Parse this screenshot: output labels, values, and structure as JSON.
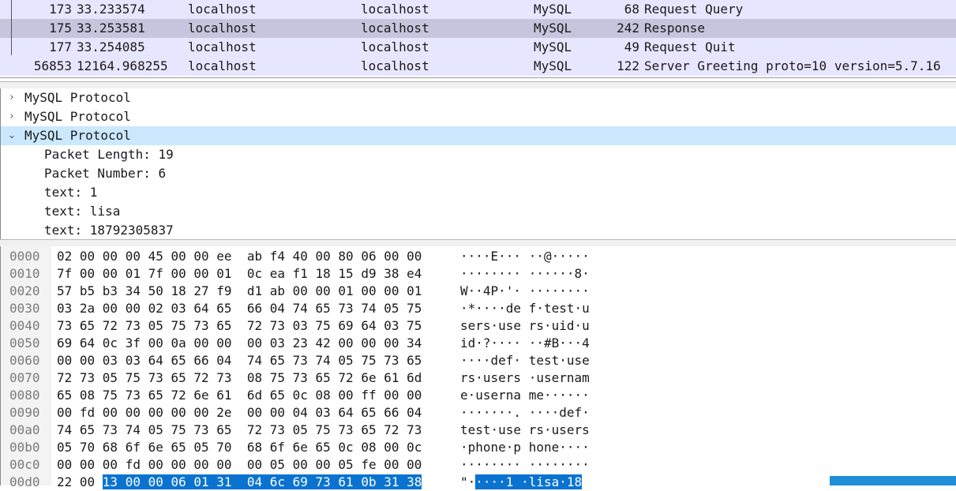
{
  "packets": [
    {
      "no": "173",
      "time": "33.233574",
      "src": "localhost",
      "dst": "localhost",
      "proto": "MySQL",
      "len": "68",
      "info": "Request Query",
      "selected": false
    },
    {
      "no": "175",
      "time": "33.253581",
      "src": "localhost",
      "dst": "localhost",
      "proto": "MySQL",
      "len": "242",
      "info": "Response",
      "selected": true
    },
    {
      "no": "177",
      "time": "33.254085",
      "src": "localhost",
      "dst": "localhost",
      "proto": "MySQL",
      "len": "49",
      "info": "Request Quit",
      "selected": false
    },
    {
      "no": "56853",
      "time": "12164.968255",
      "src": "localhost",
      "dst": "localhost",
      "proto": "MySQL",
      "len": "122",
      "info": "Server Greeting proto=10 version=5.7.16",
      "selected": false
    }
  ],
  "details": {
    "nodes": [
      {
        "label": "MySQL Protocol",
        "expanded": false
      },
      {
        "label": "MySQL Protocol",
        "expanded": false
      },
      {
        "label": "MySQL Protocol",
        "expanded": true
      }
    ],
    "children": [
      "Packet Length: 19",
      "Packet Number: 6",
      "text: 1",
      "text: lisa",
      "text: 18792305837"
    ]
  },
  "bytes": [
    {
      "off": "0000",
      "hex": "02 00 00 00 45 00 00 ee  ab f4 40 00 80 06 00 00",
      "ascii": "····E··· ··@·····"
    },
    {
      "off": "0010",
      "hex": "7f 00 00 01 7f 00 00 01  0c ea f1 18 15 d9 38 e4",
      "ascii": "········ ······8·"
    },
    {
      "off": "0020",
      "hex": "57 b5 b3 34 50 18 27 f9  d1 ab 00 00 01 00 00 01",
      "ascii": "W··4P·'· ········"
    },
    {
      "off": "0030",
      "hex": "03 2a 00 00 02 03 64 65  66 04 74 65 73 74 05 75",
      "ascii": "·*····de f·test·u"
    },
    {
      "off": "0040",
      "hex": "73 65 72 73 05 75 73 65  72 73 03 75 69 64 03 75",
      "ascii": "sers·use rs·uid·u"
    },
    {
      "off": "0050",
      "hex": "69 64 0c 3f 00 0a 00 00  00 03 23 42 00 00 00 34",
      "ascii": "id·?···· ··#B···4"
    },
    {
      "off": "0060",
      "hex": "00 00 03 03 64 65 66 04  74 65 73 74 05 75 73 65",
      "ascii": "····def· test·use"
    },
    {
      "off": "0070",
      "hex": "72 73 05 75 73 65 72 73  08 75 73 65 72 6e 61 6d",
      "ascii": "rs·users ·usernam"
    },
    {
      "off": "0080",
      "hex": "65 08 75 73 65 72 6e 61  6d 65 0c 08 00 ff 00 00",
      "ascii": "e·userna me······"
    },
    {
      "off": "0090",
      "hex": "00 fd 00 00 00 00 00 2e  00 00 04 03 64 65 66 04",
      "ascii": "·······. ····def·"
    },
    {
      "off": "00a0",
      "hex": "74 65 73 74 05 75 73 65  72 73 05 75 73 65 72 73",
      "ascii": "test·use rs·users"
    },
    {
      "off": "00b0",
      "hex": "05 70 68 6f 6e 65 05 70  68 6f 6e 65 0c 08 00 0c",
      "ascii": "·phone·p hone····"
    },
    {
      "off": "00c0",
      "hex": "00 00 00 fd 00 00 00 00  00 05 00 00 05 fe 00 00",
      "ascii": "········ ········"
    },
    {
      "off": "00d0",
      "hex_plain": "22 00 ",
      "hex_hl": "13 00 00 06 01 31  04 6c 69 73 61 0b 31 38",
      "ascii_plain": "\"·",
      "ascii_hl": "····1 ·lisa·18"
    }
  ],
  "colors": {
    "row_bg": "#e7e6ff",
    "row_selected": "#c6c5dd",
    "tree_selected": "#cce8ff",
    "byte_highlight": "#0a73d1"
  }
}
